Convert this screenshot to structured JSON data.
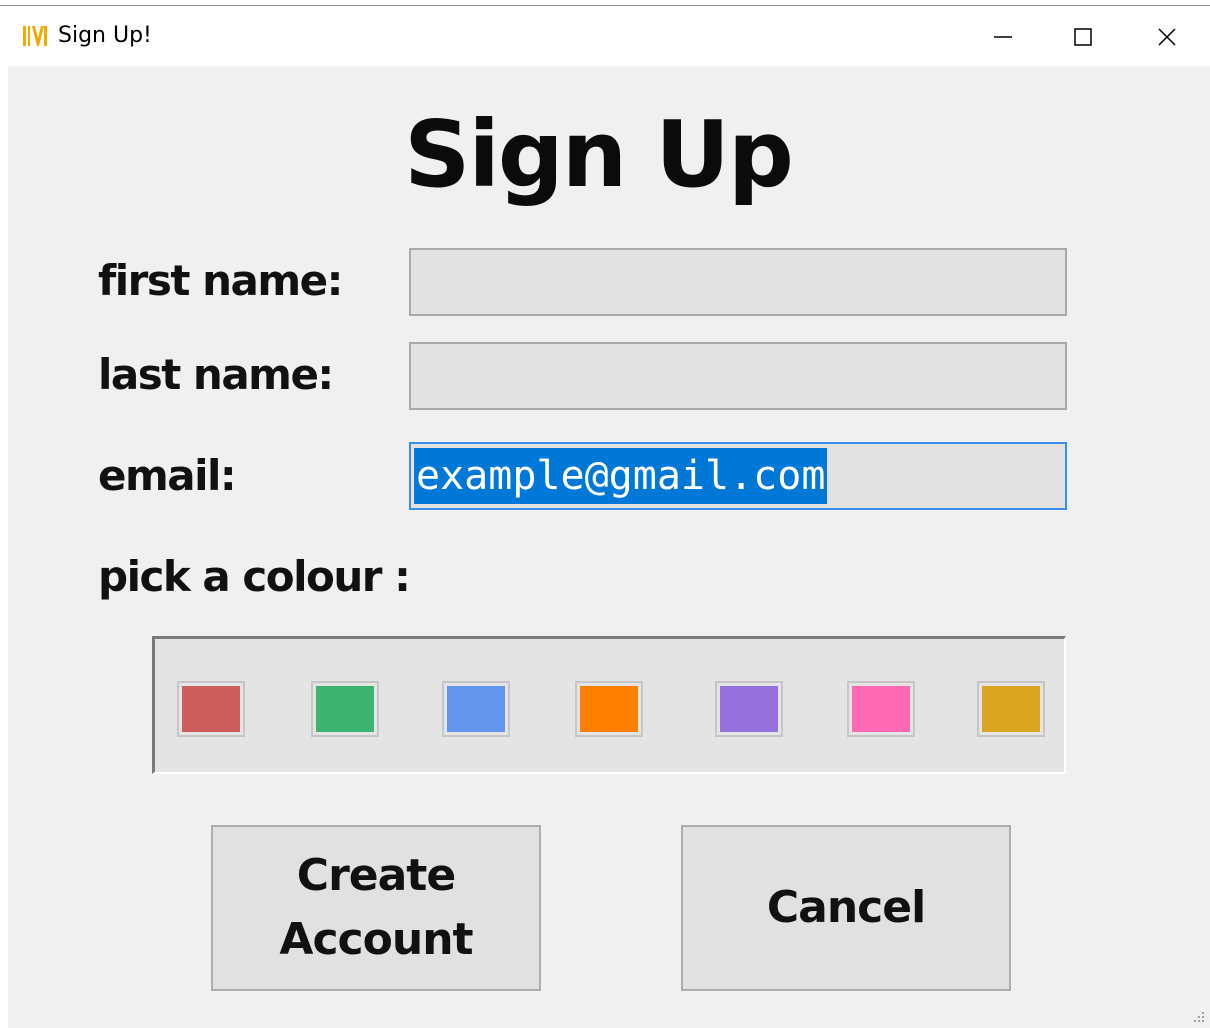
{
  "window": {
    "title": "Sign Up!",
    "minimize_glyph": "minimize-icon",
    "maximize_glyph": "maximize-icon",
    "close_glyph": "close-icon",
    "app_icon": "tkinter-feather-icon"
  },
  "form": {
    "heading": "Sign Up",
    "first_name": {
      "label": "first name:",
      "value": ""
    },
    "last_name": {
      "label": "last name:",
      "value": ""
    },
    "email": {
      "label": "email:",
      "value": "example@gmail.com",
      "selected": true
    },
    "colour_label": "pick a colour :"
  },
  "palette": {
    "swatches": [
      {
        "name": "red",
        "color": "#cd5c5c"
      },
      {
        "name": "green",
        "color": "#3cb371"
      },
      {
        "name": "blue",
        "color": "#6495ed"
      },
      {
        "name": "orange",
        "color": "#ff7f00"
      },
      {
        "name": "purple",
        "color": "#9370db"
      },
      {
        "name": "pink",
        "color": "#ff69b4"
      },
      {
        "name": "gold",
        "color": "#daa520"
      }
    ]
  },
  "buttons": {
    "create_line1": "Create",
    "create_line2": "Account",
    "cancel": "Cancel"
  },
  "colors": {
    "selection": "#0078d7",
    "focus_border": "#3d8ee8",
    "background": "#f0f0f0"
  }
}
